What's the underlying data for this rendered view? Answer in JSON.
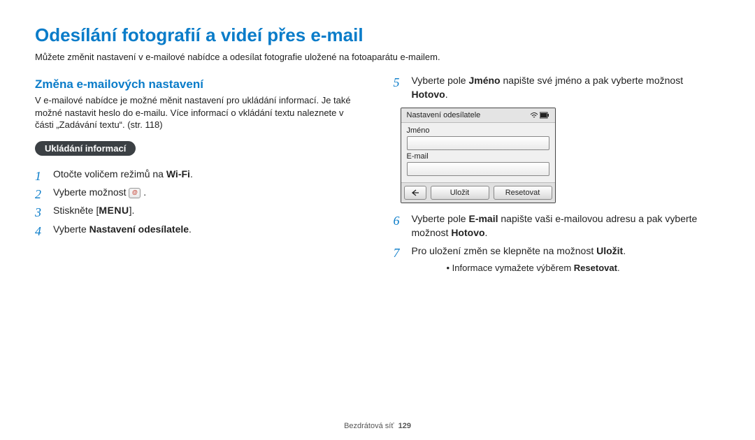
{
  "title": "Odesílání fotografií a videí přes e-mail",
  "intro": "Můžete změnit nastavení v e-mailové nabídce a odesílat fotografie uložené na fotoaparátu e-mailem.",
  "left": {
    "section_title": "Změna e-mailových nastavení",
    "section_desc": "V e-mailové nabídce je možné měnit nastavení pro ukládání informací. Je také možné nastavit heslo do e-mailu. Více informací o vkládání textu naleznete v části „Zadávání textu“. (str. 118)",
    "pill": "Ukládání informací",
    "steps": {
      "1_pre": "Otočte voličem režimů na ",
      "1_wifi": "Wi-Fi",
      "2_pre": "Vyberte možnost ",
      "3_pre": "Stiskněte [",
      "3_menu": "MENU",
      "3_post": "].",
      "4_pre": "Vyberte ",
      "4_bold": "Nastavení odesílatele",
      "4_post": "."
    }
  },
  "right": {
    "steps": {
      "5_pre": "Vyberte pole ",
      "5_b1": "Jméno",
      "5_mid": " napište své jméno a pak vyberte možnost ",
      "5_b2": "Hotovo",
      "5_post": ".",
      "6_pre": "Vyberte pole ",
      "6_b1": "E-mail",
      "6_mid": " napište vaši e-mailovou adresu a pak vyberte možnost ",
      "6_b2": "Hotovo",
      "6_post": ".",
      "7_pre": "Pro uložení změn se klepněte na možnost ",
      "7_b1": "Uložit",
      "7_post": "."
    },
    "bullet_pre": "Informace vymažete výběrem ",
    "bullet_b": "Resetovat",
    "bullet_post": "."
  },
  "shot": {
    "header": "Nastavení odesílatele",
    "label_name": "Jméno",
    "label_email": "E-mail",
    "btn_save": "Uložit",
    "btn_reset": "Resetovat"
  },
  "footer": {
    "section": "Bezdrátová síť",
    "page": "129"
  }
}
